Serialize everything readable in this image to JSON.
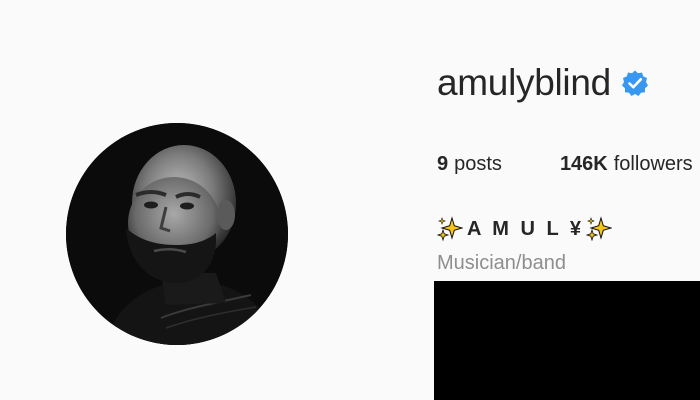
{
  "profile": {
    "username": "amulyblind",
    "verified": true,
    "full_name": "A M U L ¥",
    "category": "Musician/band"
  },
  "stats": {
    "posts_count": "9",
    "posts_label": "posts",
    "followers_count": "146K",
    "followers_label": "followers"
  },
  "colors": {
    "background": "#fafafa",
    "text": "#262626",
    "muted": "#8e8e8e",
    "verified_blue": "#3897f0",
    "sparkle": "#f5c518"
  },
  "icons": {
    "verified": "verified-badge-icon",
    "sparkle": "sparkles-icon"
  }
}
